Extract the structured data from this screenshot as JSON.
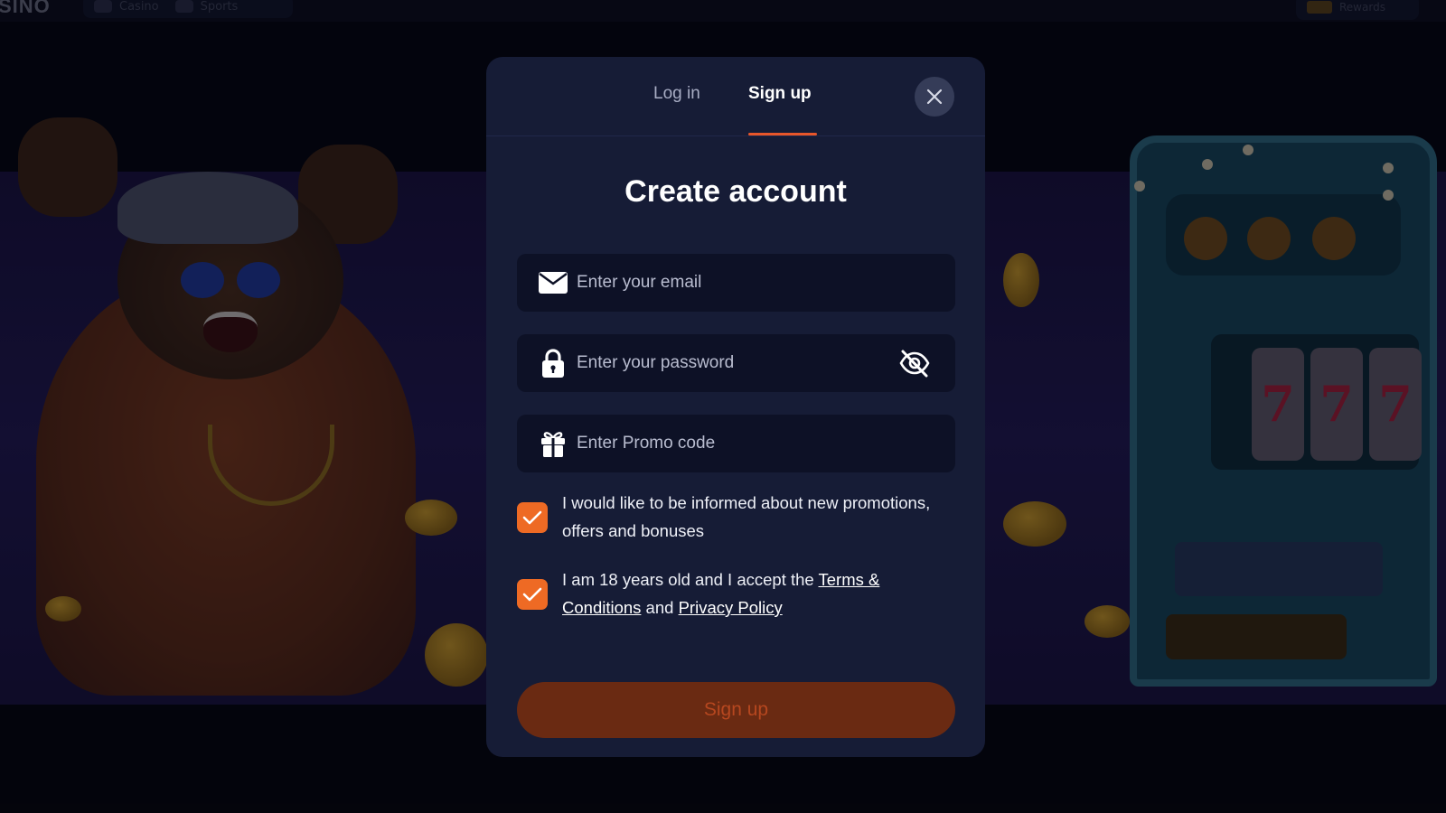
{
  "background": {
    "logo_text": "SINO",
    "nav": [
      {
        "label": "Casino",
        "icon": "casino-icon"
      },
      {
        "label": "Sports",
        "icon": "sports-icon"
      }
    ],
    "top_right_label": "Rewards",
    "slot_reels": [
      "7",
      "7",
      "7"
    ]
  },
  "modal": {
    "tabs": {
      "login": "Log in",
      "signup": "Sign up",
      "active": "signup"
    },
    "title": "Create account",
    "fields": {
      "email": {
        "placeholder": "Enter your email",
        "value": "",
        "icon": "envelope-icon"
      },
      "password": {
        "placeholder": "Enter your password",
        "value": "",
        "icon": "lock-icon",
        "toggle_icon": "eye-slash-icon"
      },
      "promo": {
        "placeholder": "Enter Promo code",
        "value": "",
        "icon": "gift-icon"
      }
    },
    "checks": {
      "promotions": {
        "checked": true,
        "text": "I would like to be informed about new promotions, offers and bonuses"
      },
      "terms": {
        "checked": true,
        "text_before": "I am 18 years old and I accept the ",
        "terms_link": "Terms & Conditions",
        "text_middle": " and ",
        "privacy_link": "Privacy Policy"
      }
    },
    "submit_label": "Sign up"
  },
  "colors": {
    "modal_bg": "#161c36",
    "field_bg": "#0d1126",
    "accent": "#ee6a24",
    "submit_disabled_bg": "#6a2a12",
    "submit_disabled_text": "#b6471f"
  }
}
